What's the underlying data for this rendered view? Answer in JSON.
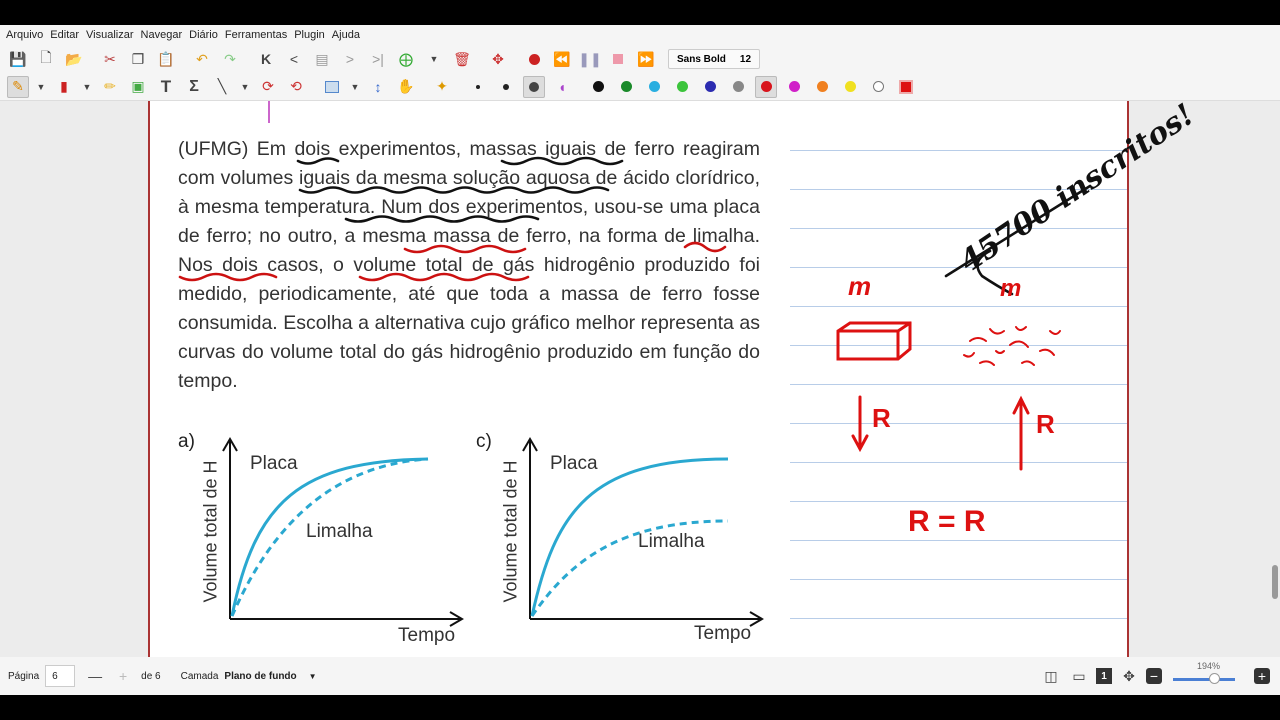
{
  "menu": [
    "Arquivo",
    "Editar",
    "Visualizar",
    "Navegar",
    "Diário",
    "Ferramentas",
    "Plugin",
    "Ajuda"
  ],
  "font": {
    "name": "Sans Bold",
    "size": "12"
  },
  "toolbar1_icons": [
    "save-icon",
    "new-page-icon",
    "open-icon",
    "cut-icon",
    "copy-icon",
    "paste-icon",
    "undo-icon",
    "redo-icon",
    "first-page-icon",
    "prev-page-icon",
    "page-icon",
    "next-page-icon",
    "last-page-icon",
    "add-page-icon",
    "dropdown-icon",
    "delete-page-icon",
    "fullscreen-icon",
    "record-icon",
    "rewind-icon",
    "pause-icon",
    "stop-icon",
    "fast-forward-icon"
  ],
  "colors": [
    "#000000",
    "#1a8a2a",
    "#29aee0",
    "#3bc43b",
    "#2b2bb0",
    "#888888",
    "#d8141c",
    "#d020c8",
    "#f08020",
    "#f0e020",
    "#ffffff",
    "#dd1111"
  ],
  "problem": {
    "text": "(UFMG) Em dois experimentos, massas iguais de ferro reagiram com volumes iguais da mesma solução aquosa de ácido clorídrico, à mesma temperatura. Num dos experimentos, usou-se uma placa de ferro; no outro, a mesma massa de ferro, na forma de limalha. Nos dois casos, o volume total de gás hidrogênio produzido foi medido, periodicamente, até que toda a massa de ferro fosse consumida. Escolha a alternativa cujo gráfico melhor representa as curvas do volume total do gás hidrogênio produzido em função do tempo."
  },
  "graph_a": {
    "letter": "a)",
    "ylabel": "Volume total de H",
    "xlabel": "Tempo",
    "placa": "Placa",
    "limalha": "Limalha"
  },
  "graph_c": {
    "letter": "c)",
    "ylabel": "Volume total de H",
    "xlabel": "Tempo",
    "placa": "Placa",
    "limalha": "Limalha"
  },
  "annotations": {
    "top_note": "45700 inscritos!",
    "m1": "m",
    "m2": "m",
    "r_down": "R",
    "r_up": "R",
    "equation": "R = R"
  },
  "status": {
    "page_label": "Página",
    "page_value": "6",
    "of_label": "de 6",
    "layer_label": "Camada",
    "layer_value": "Plano de fundo",
    "zoom": "194%"
  }
}
